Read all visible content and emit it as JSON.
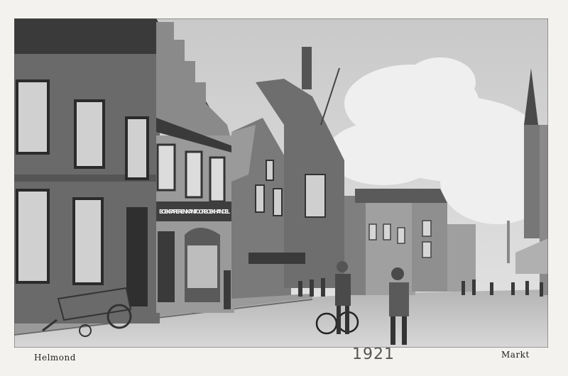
{
  "postcard": {
    "caption_left": "Helmond",
    "caption_right": "Markt",
    "handwritten_year": "1921",
    "shop_sign": "BOEK-PAPIER-EN KANTOORBOEKHANDEL"
  }
}
